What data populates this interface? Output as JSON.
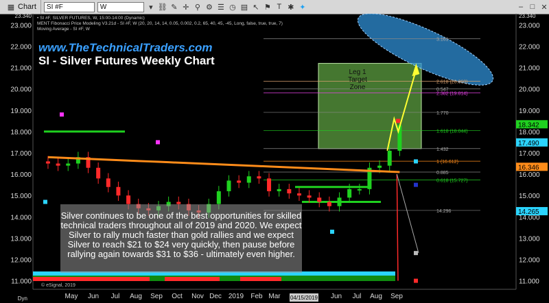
{
  "toolbar": {
    "tab_label": "Chart",
    "symbol": "SI #F",
    "interval": "W",
    "icons": [
      "chart-icon",
      "dropdown-icon",
      "link-icon",
      "pencil-icon",
      "crosshair-icon",
      "zoom-icon",
      "gear-icon",
      "list-icon",
      "clock-icon",
      "grid-icon",
      "cursor-icon",
      "pin-icon",
      "text-icon",
      "settings-icon",
      "twitter-icon",
      "minimize-icon",
      "maximize-icon",
      "close-icon"
    ]
  },
  "info_lines": [
    "• SI #F, SILVER FUTURES, W, 15:00-14:00 (Dynamic)",
    "MENT Fibonacci Price Modeling V3.21d - SI #F, W (20, 20, 14, 14, 0.05, 0.002, 0.2, 65, 40, 45, -45, Long, false, true, true, 7)",
    "Moving Average - SI #F, W"
  ],
  "header": {
    "website": "www.TheTechnicalTraders.com",
    "chart_title": "SI - Silver Futures Weekly Chart"
  },
  "zone_label": "Leg 1\nTarget\nZone",
  "description": "Silver continues to be one of the best opportunities for skilled technical traders throughout all of 2019 and 2020.  We expect Silver to rally much faster than gold rallies and we expect Silver to reach $21 to $24 very quickly, then pause before rallying again towards $31 to $36 - ultimately even higher.",
  "copyright": "© eSignal, 2019",
  "tag_left": "Dyn",
  "date_tag": "04/15/2019",
  "chart_data": {
    "type": "line",
    "title": "SI - Silver Futures Weekly Chart",
    "ylim": [
      10.6,
      23.4
    ],
    "y_ticks": [
      11.0,
      12.0,
      13.0,
      14.0,
      15.0,
      16.0,
      17.0,
      18.0,
      19.0,
      20.0,
      21.0,
      22.0,
      23.0
    ],
    "y_tick_labels_left": [
      "11.000",
      "12.000",
      "13.000",
      "14.000",
      "15.000",
      "16.000",
      "17.000",
      "18.000",
      "19.000",
      "20.000",
      "21.000",
      "22.000",
      "23.000"
    ],
    "y_tick_labels_right": [
      "11.000",
      "12.000",
      "13.000",
      "14.000",
      "15.000",
      "16.000",
      "17.000",
      "18.000",
      "19.000",
      "20.000",
      "21.000",
      "22.000",
      "23.000"
    ],
    "top_label_left": "23.340",
    "top_label_right": "23.340",
    "x_labels": [
      "May",
      "Jun",
      "Jul",
      "Aug",
      "Sep",
      "Oct",
      "Nov",
      "Dec",
      "2019",
      "Feb",
      "Mar",
      "",
      "Jun",
      "Jul",
      "Aug",
      "Sep"
    ],
    "series": [
      {
        "name": "SI #F",
        "x": [
          "2018-04-27",
          "2018-05-11",
          "2018-05-25",
          "2018-06-08",
          "2018-06-22",
          "2018-07-06",
          "2018-07-20",
          "2018-08-03",
          "2018-08-17",
          "2018-08-31",
          "2018-09-14",
          "2018-09-28",
          "2018-10-12",
          "2018-10-26",
          "2018-11-09",
          "2018-11-23",
          "2018-12-07",
          "2018-12-21",
          "2019-01-04",
          "2019-01-18",
          "2019-02-01",
          "2019-02-15",
          "2019-03-01",
          "2019-03-15",
          "2019-03-29",
          "2019-04-12",
          "2019-04-26",
          "2019-05-10",
          "2019-05-24",
          "2019-06-07",
          "2019-06-21",
          "2019-07-05",
          "2019-07-19",
          "2019-08-02",
          "2019-08-16",
          "2019-08-30"
        ],
        "values": [
          16.5,
          16.4,
          16.5,
          16.8,
          16.3,
          15.8,
          15.4,
          15.0,
          14.6,
          14.4,
          14.3,
          14.5,
          14.7,
          14.6,
          14.3,
          14.2,
          14.6,
          15.2,
          15.7,
          15.6,
          15.9,
          15.8,
          15.2,
          15.3,
          15.1,
          15.0,
          14.9,
          14.7,
          14.5,
          14.9,
          15.3,
          15.3,
          16.3,
          16.4,
          17.1,
          18.3
        ]
      }
    ],
    "fib_levels": [
      {
        "label": "3.161",
        "value": 22.35
      },
      {
        "label": "2.618 (20.360)",
        "value": 20.36
      },
      {
        "label": "0.547",
        "value": 20.0
      },
      {
        "label": "2.382 (19.814)",
        "value": 19.81
      },
      {
        "label": "1.770",
        "value": 18.9
      },
      {
        "label": "1.618 (18.044)",
        "value": 18.04
      },
      {
        "label": "1.432",
        "value": 17.2
      },
      {
        "label": "1 (16.612)",
        "value": 16.61
      },
      {
        "label": "0.885",
        "value": 16.1
      },
      {
        "label": "0.618 (15.727)",
        "value": 15.73
      },
      {
        "label": "14.296",
        "value": 14.3
      }
    ],
    "price_tags": [
      {
        "label": "18.342",
        "value": 18.342,
        "color": "#1fd11f"
      },
      {
        "label": "17.490",
        "value": 17.49,
        "color": "#2bd4ff"
      },
      {
        "label": "16.346",
        "value": 16.346,
        "color": "#ff8c1a"
      },
      {
        "label": "14.265",
        "value": 14.265,
        "color": "#2bd4ff"
      }
    ],
    "target_zone": {
      "y_from": 17.2,
      "y_to": 21.2
    },
    "projection_ellipse_center": [
      22.0,
      21.6
    ],
    "grid": false,
    "colors": {
      "background": "#000000",
      "up_candle": "#1fd11f",
      "down_candle": "#ff2a2a",
      "moving_average": "#ff8c1a",
      "website": "#3aa0ff",
      "zone": "#7ed957",
      "ellipse": "#2f8fd6",
      "arrow": "#ffff33"
    }
  }
}
